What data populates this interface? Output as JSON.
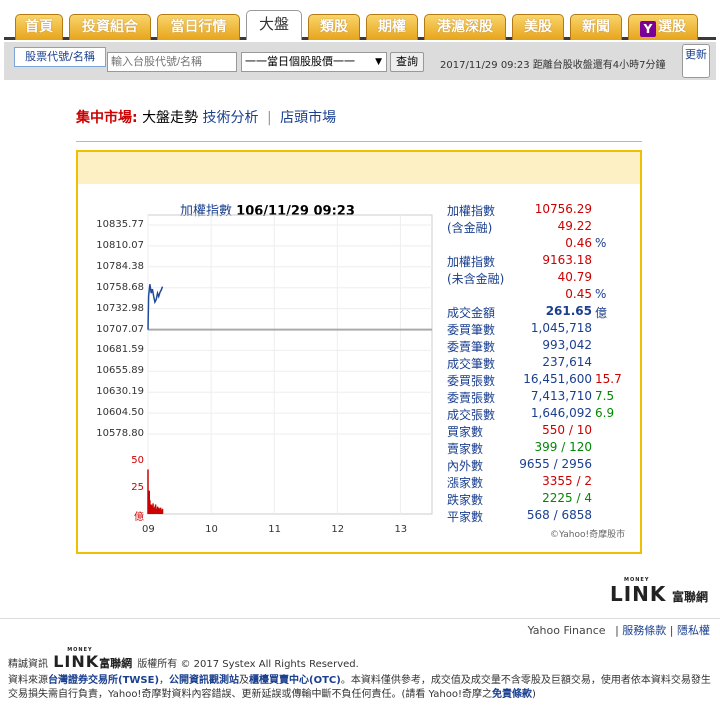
{
  "nav": {
    "tabs": [
      "首頁",
      "投資組合",
      "當日行情",
      "大盤",
      "類股",
      "期權",
      "港滬深股",
      "美股",
      "新聞",
      "選股"
    ],
    "active_index": 3,
    "yahoo_icon": "Y"
  },
  "toolbar": {
    "code_label": "股票代號/名稱",
    "search_placeholder": "輸入台股代號/名稱",
    "select_value": "一一當日個股股價一一",
    "query_button": "查詢",
    "clock_text": "2017/11/29 09:23 距離台股收盤還有4小時7分鐘",
    "refresh_button": "更新"
  },
  "breadcrumb": {
    "label": "集中市場:",
    "current": "大盤走勢",
    "link1": "技術分析",
    "separator": "|",
    "link2": "店頭市場"
  },
  "chart_data": {
    "type": "line",
    "title": "加權指數",
    "timestamp": "106/11/29 09:23",
    "yticks": [
      "10835.77",
      "10810.07",
      "10784.38",
      "10758.68",
      "10732.98",
      "10707.07",
      "10681.59",
      "10655.89",
      "10630.19",
      "10604.50",
      "10578.80"
    ],
    "ylim": [
      10578.8,
      10835.77
    ],
    "reference": 10707.07,
    "xticks": [
      "09",
      "10",
      "11",
      "12",
      "13"
    ],
    "volume_ticks": [
      "50",
      "25",
      "億"
    ],
    "volume_ylim": [
      0,
      50
    ],
    "index_series": [
      {
        "t": 9.0,
        "v": 10707.07
      },
      {
        "t": 9.01,
        "v": 10748.5
      },
      {
        "t": 9.03,
        "v": 10763.0
      },
      {
        "t": 9.05,
        "v": 10752.0
      },
      {
        "t": 9.07,
        "v": 10757.0
      },
      {
        "t": 9.09,
        "v": 10748.0
      },
      {
        "t": 9.11,
        "v": 10741.0
      },
      {
        "t": 9.13,
        "v": 10744.0
      },
      {
        "t": 9.15,
        "v": 10752.0
      },
      {
        "t": 9.17,
        "v": 10748.0
      },
      {
        "t": 9.19,
        "v": 10753.0
      },
      {
        "t": 9.21,
        "v": 10756.0
      },
      {
        "t": 9.23,
        "v": 10760.0
      }
    ],
    "volume_series": [
      {
        "t": 9.0,
        "v": 42
      },
      {
        "t": 9.02,
        "v": 22
      },
      {
        "t": 9.03,
        "v": 13
      },
      {
        "t": 9.05,
        "v": 9
      },
      {
        "t": 9.06,
        "v": 8
      },
      {
        "t": 9.08,
        "v": 10
      },
      {
        "t": 9.09,
        "v": 6
      },
      {
        "t": 9.11,
        "v": 7
      },
      {
        "t": 9.12,
        "v": 9
      },
      {
        "t": 9.14,
        "v": 5
      },
      {
        "t": 9.15,
        "v": 7
      },
      {
        "t": 9.17,
        "v": 6
      },
      {
        "t": 9.18,
        "v": 5
      },
      {
        "t": 9.2,
        "v": 6
      },
      {
        "t": 9.21,
        "v": 4
      },
      {
        "t": 9.23,
        "v": 5
      }
    ],
    "copyright": "©Yahoo!奇摩股市",
    "line_color": "#1f4a9c",
    "volume_color": "#cc0000"
  },
  "stats": [
    {
      "label": "加權指數",
      "value": "10756.29",
      "vcolor": "#c00",
      "extra": ""
    },
    {
      "label": "(含金融)",
      "value": "49.22",
      "vcolor": "#c00",
      "extra": ""
    },
    {
      "label": "",
      "value": "0.46",
      "vcolor": "#c00",
      "extra": "%"
    },
    {
      "label": "加權指數",
      "value": "9163.18",
      "vcolor": "#c00",
      "extra": ""
    },
    {
      "label": "(未含金融)",
      "value": "40.79",
      "vcolor": "#c00",
      "extra": ""
    },
    {
      "label": "",
      "value": "0.45",
      "vcolor": "#c00",
      "extra": "%"
    },
    {
      "label": "成交金額",
      "value": "261.65",
      "vcolor": "#1a3f8f",
      "extra": "億"
    },
    {
      "label": "委買筆數",
      "value": "1,045,718",
      "vcolor": "#1a3f8f",
      "extra": ""
    },
    {
      "label": "委賣筆數",
      "value": "993,042",
      "vcolor": "#1a3f8f",
      "extra": ""
    },
    {
      "label": "成交筆數",
      "value": "237,614",
      "vcolor": "#1a3f8f",
      "extra": ""
    },
    {
      "label": "委買張數",
      "value": "16,451,600",
      "vcolor": "#1a3f8f",
      "extra": "15.7"
    },
    {
      "label": "委賣張數",
      "value": "7,413,710",
      "vcolor": "#1a3f8f",
      "extra": "7.5"
    },
    {
      "label": "成交張數",
      "value": "1,646,092",
      "vcolor": "#1a3f8f",
      "extra": "6.9"
    },
    {
      "label": "買家數",
      "value": "550 / 10",
      "vcolor": "#c00",
      "extra": ""
    },
    {
      "label": "賣家數",
      "value": "399 / 120",
      "vcolor": "#080",
      "extra": ""
    },
    {
      "label": "內外數",
      "value": "9655 / 2956",
      "vcolor": "#1a3f8f",
      "extra": ""
    },
    {
      "label": "漲家數",
      "value": "3355 / 2",
      "vcolor": "#c00",
      "extra": ""
    },
    {
      "label": "跌家數",
      "value": "2225 / 4",
      "vcolor": "#080",
      "extra": ""
    },
    {
      "label": "平家數",
      "value": "568 / 6858",
      "vcolor": "#1a3f8f",
      "extra": ""
    }
  ],
  "logo": {
    "money": "MONEY",
    "link": "LINK",
    "name": "富聯網"
  },
  "footer": {
    "yahoo_finance": "Yahoo Finance",
    "terms": "服務條款",
    "sep": "|",
    "privacy": "隱私權",
    "provider_prefix": "精誠資訊",
    "copyright": "版權所有 © 2017 Systex All Rights Reserved.",
    "disc_1": "資料來源",
    "disc_twse": "台灣證券交易所(TWSE)",
    "disc_2": "，",
    "disc_mops": "公開資訊觀測站",
    "disc_3": "及",
    "disc_otc": "櫃檯買賣中心(OTC)",
    "disc_4": "。本資料僅供參考，成交值及成交量不含零股及巨額交易，使用者依本資料交易發生交易損失需自行負責，Yahoo!奇摩對資料內容錯誤、更新延誤或傳輸中斷不負任何責任。(請看 Yahoo!奇摩之",
    "disc_terms": "免責條款",
    "disc_5": ")"
  }
}
